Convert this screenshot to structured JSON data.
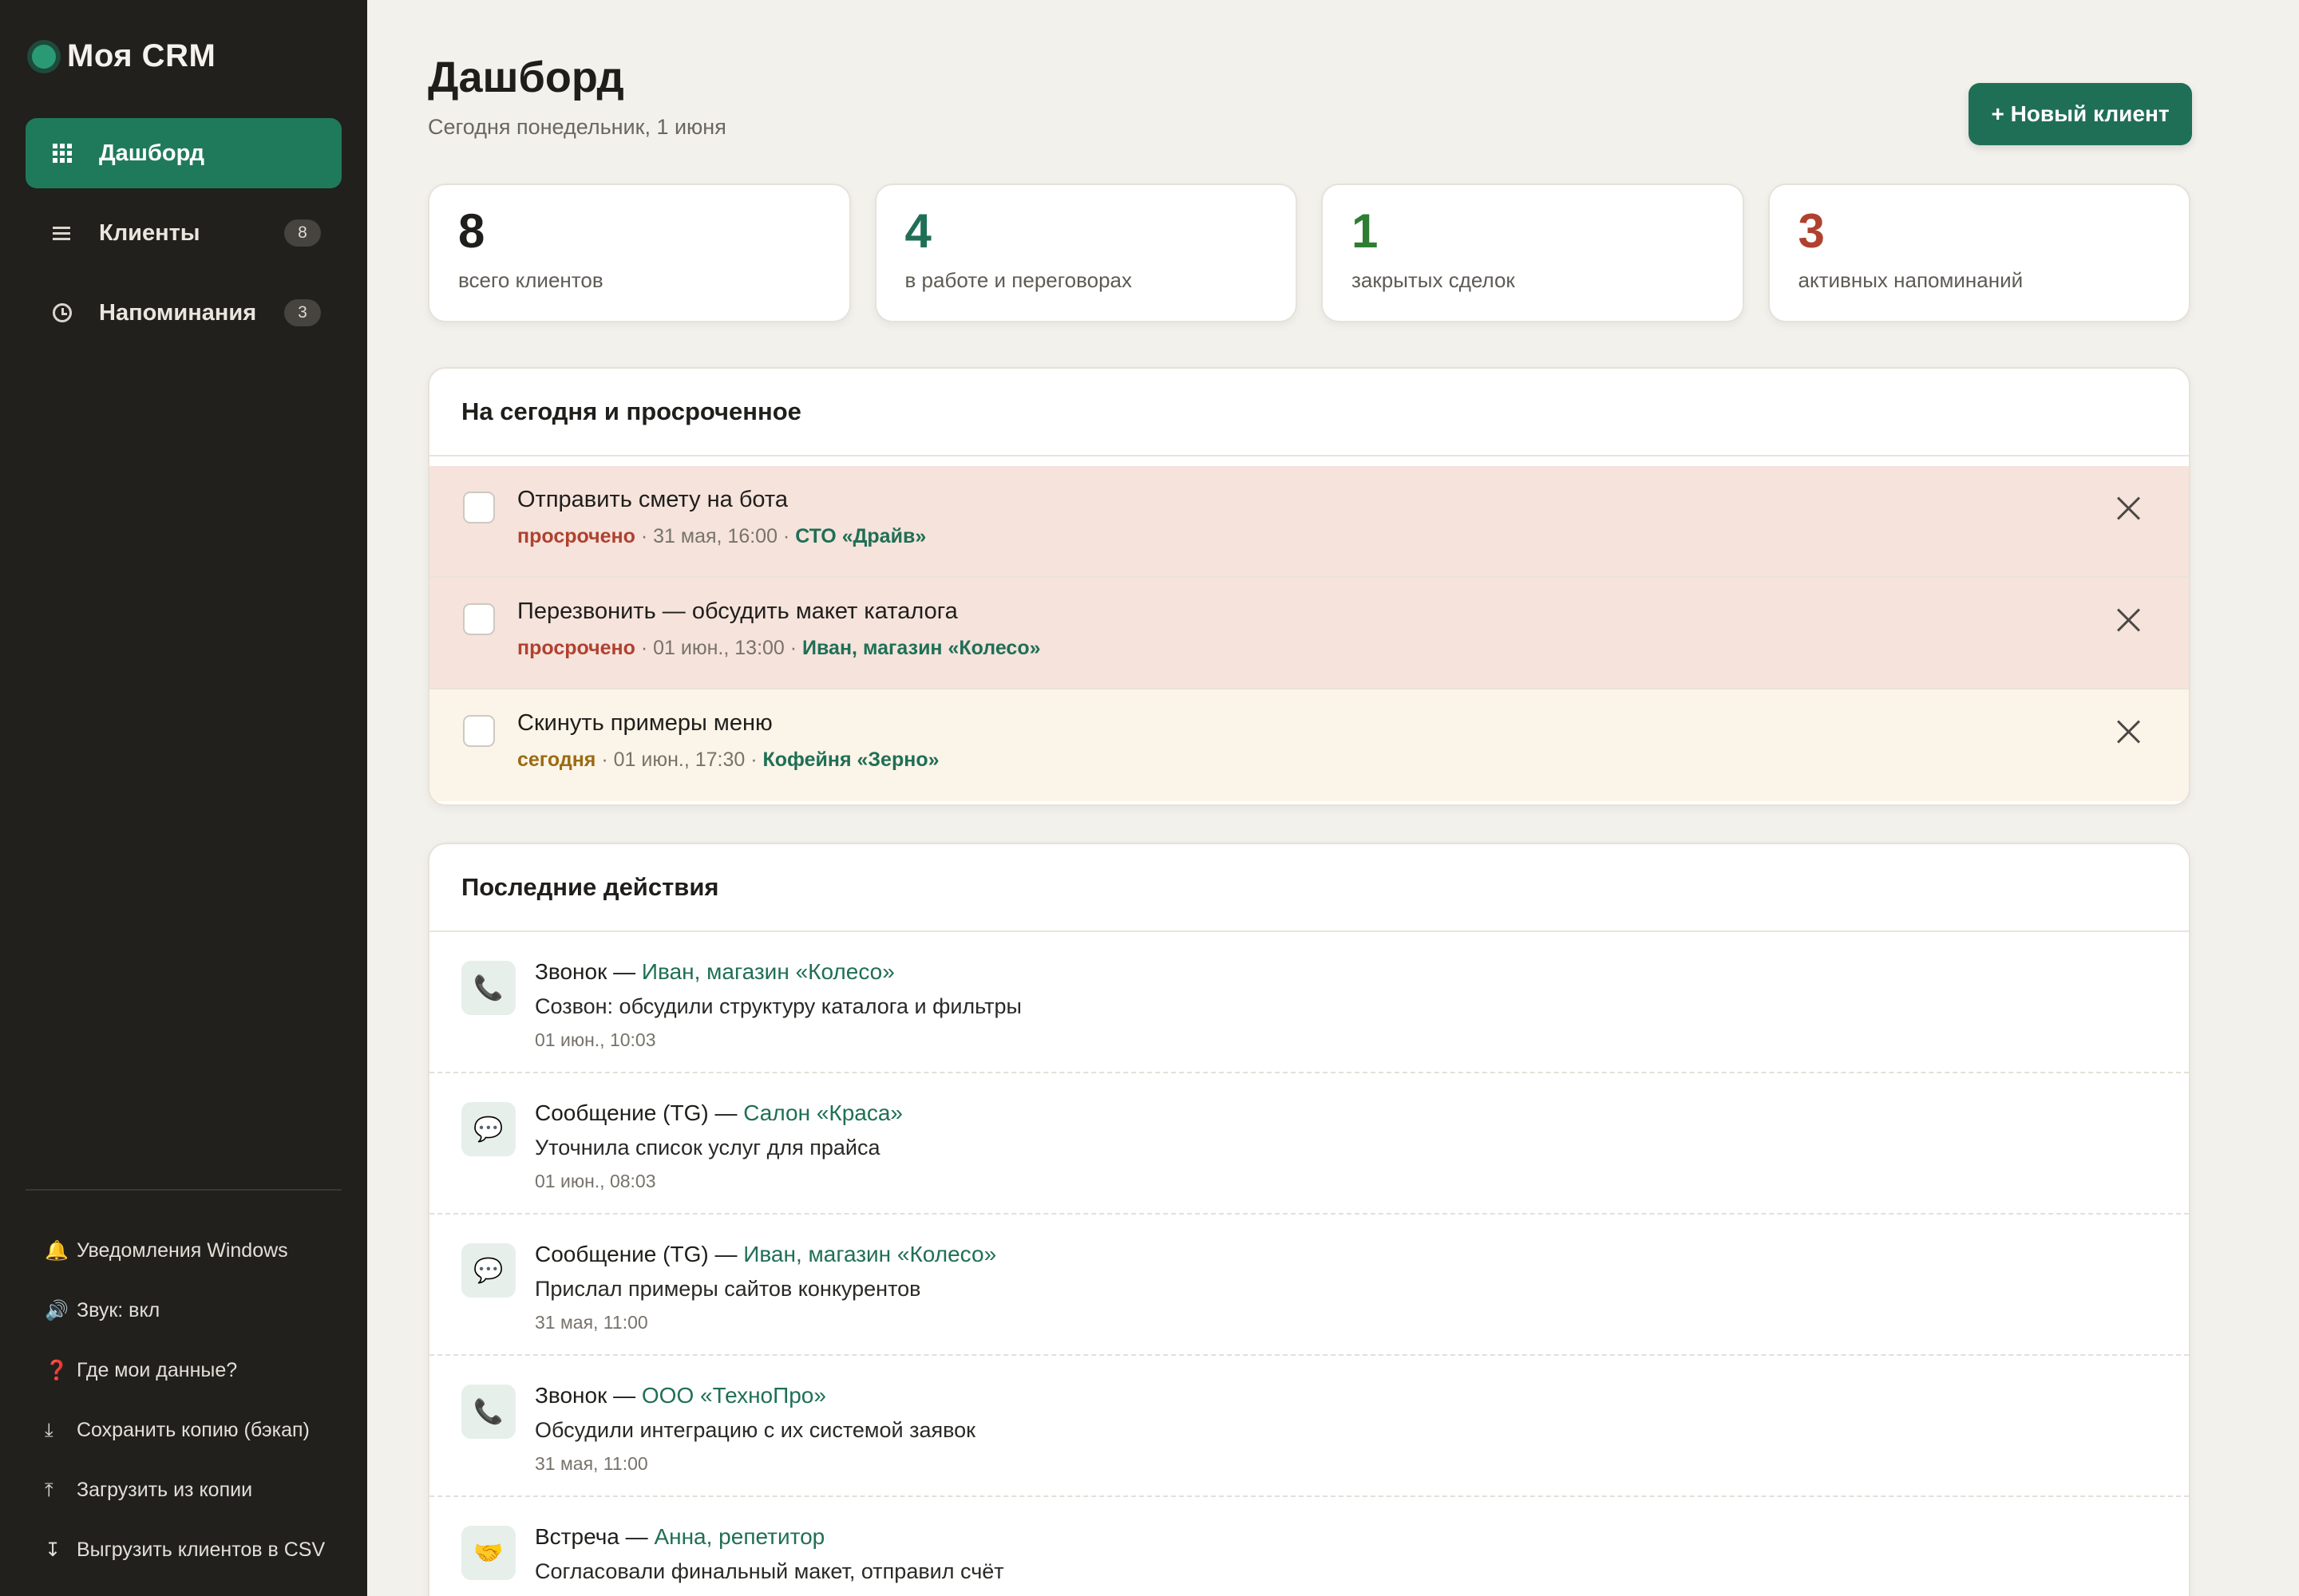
{
  "app": {
    "name": "Моя CRM"
  },
  "sidebar": {
    "items": [
      {
        "label": "Дашборд",
        "icon": "dashboard-grid-icon",
        "active": true
      },
      {
        "label": "Клиенты",
        "icon": "list-icon",
        "badge": "8"
      },
      {
        "label": "Напоминания",
        "icon": "clock-icon",
        "badge": "3"
      }
    ],
    "links": [
      {
        "glyph": "🔔",
        "label": "Уведомления Windows"
      },
      {
        "glyph": "🔊",
        "label": "Звук: вкл"
      },
      {
        "glyph": "❓",
        "label": "Где мои данные?"
      },
      {
        "glyph": "⤓",
        "label": "Сохранить копию (бэкап)"
      },
      {
        "glyph": "⤒",
        "label": "Загрузить из копии"
      },
      {
        "glyph": "↧",
        "label": "Выгрузить клиентов в CSV"
      }
    ]
  },
  "header": {
    "title": "Дашборд",
    "subtitle": "Сегодня понедельник, 1 июня",
    "new_client_label": "+ Новый клиент"
  },
  "stats": [
    {
      "value": "8",
      "label": "всего клиентов",
      "color": "#1f1e1b"
    },
    {
      "value": "4",
      "label": "в работе и переговорах",
      "color": "#1f6f56"
    },
    {
      "value": "1",
      "label": "закрытых сделок",
      "color": "#2e7d32"
    },
    {
      "value": "3",
      "label": "активных напоминаний",
      "color": "#b0412f"
    }
  ],
  "reminders": {
    "title": "На сегодня и просроченное",
    "items": [
      {
        "title": "Отправить смету на бота",
        "status": "просрочено",
        "when": " · 31 мая, 16:00 · ",
        "client": "СТО «Драйв»"
      },
      {
        "title": "Перезвонить — обсудить макет каталога",
        "status": "просрочено",
        "when": " · 01 июн., 13:00 · ",
        "client": "Иван, магазин «Колесо»"
      },
      {
        "title": "Скинуть примеры меню",
        "status": "сегодня",
        "when": " · 01 июн., 17:30 · ",
        "client": "Кофейня «Зерно»"
      }
    ]
  },
  "activity": {
    "title": "Последние действия",
    "items": [
      {
        "icon": "phone-icon",
        "glyph": "📞",
        "type": "Звонок — ",
        "client": "Иван, магазин «Колесо»",
        "text": "Созвон: обсудили структуру каталога и фильтры",
        "time": "01 июн., 10:03"
      },
      {
        "icon": "message-icon",
        "glyph": "💬",
        "type": "Сообщение (TG) — ",
        "client": "Салон «Краса»",
        "text": "Уточнила список услуг для прайса",
        "time": "01 июн., 08:03"
      },
      {
        "icon": "message-icon",
        "glyph": "💬",
        "type": "Сообщение (TG) — ",
        "client": "Иван, магазин «Колесо»",
        "text": "Прислал примеры сайтов конкурентов",
        "time": "31 мая, 11:00"
      },
      {
        "icon": "phone-icon",
        "glyph": "📞",
        "type": "Звонок — ",
        "client": "ООО «ТехноПро»",
        "text": "Обсудили интеграцию с их системой заявок",
        "time": "31 мая, 11:00"
      },
      {
        "icon": "handshake-icon",
        "glyph": "🤝",
        "type": "Встреча — ",
        "client": "Анна, репетитор",
        "text": "Согласовали финальный макет, отправил счёт",
        "time": ""
      }
    ]
  }
}
